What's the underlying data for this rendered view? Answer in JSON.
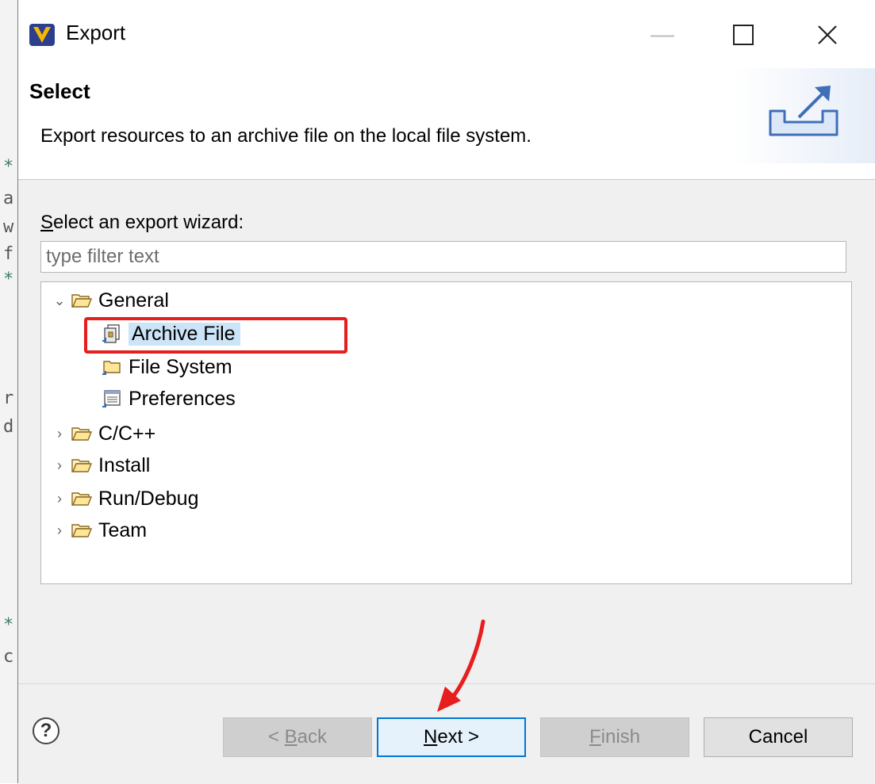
{
  "window": {
    "title": "Export"
  },
  "banner": {
    "title": "Select",
    "description": "Export resources to an archive file on the local file system."
  },
  "wizard": {
    "label": "Select an export wizard:",
    "label_mnemonic": "S",
    "label_rest": "elect an export wizard:",
    "filter_placeholder": "type filter text"
  },
  "tree": {
    "general": {
      "label": "General",
      "children": [
        "Archive File",
        "File System",
        "Preferences"
      ]
    },
    "categories": [
      "C/C++",
      "Install",
      "Run/Debug",
      "Team"
    ]
  },
  "footer": {
    "help": "?",
    "back": {
      "label": "< Back",
      "pre": "< ",
      "mnemonic": "B",
      "rest": "ack"
    },
    "next": {
      "label": "Next >",
      "mnemonic": "N",
      "rest": "ext >"
    },
    "finish": {
      "label": "Finish",
      "mnemonic": "F",
      "rest": "inish"
    },
    "cancel": {
      "label": "Cancel"
    }
  },
  "colors": {
    "annotation_red": "#e61e1e",
    "selection": "#cce4f7",
    "primary_border": "#0078d7"
  }
}
